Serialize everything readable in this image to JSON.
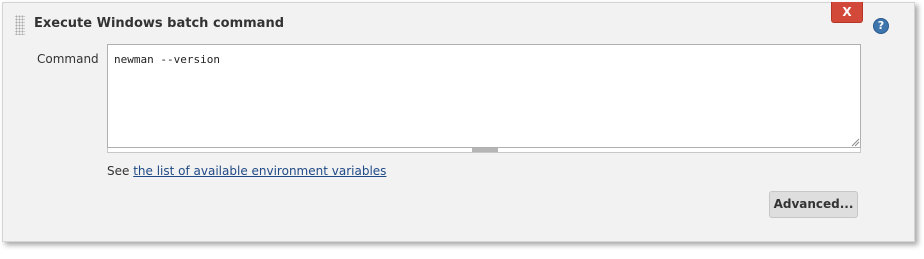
{
  "step": {
    "title": "Execute Windows batch command",
    "delete_label": "X",
    "help_label": "?"
  },
  "command": {
    "label": "Command",
    "value": "newman --version"
  },
  "env_note": {
    "prefix": "See ",
    "link_text": "the list of available environment variables"
  },
  "advanced_label": "Advanced...",
  "icons": [
    "drag-handle-icon",
    "help-icon",
    "resize-handle-icon"
  ],
  "colors": {
    "delete_button": "#d24939",
    "help_icon": "#3f75ad",
    "link": "#204a87",
    "panel_background": "#f2f2f2"
  }
}
